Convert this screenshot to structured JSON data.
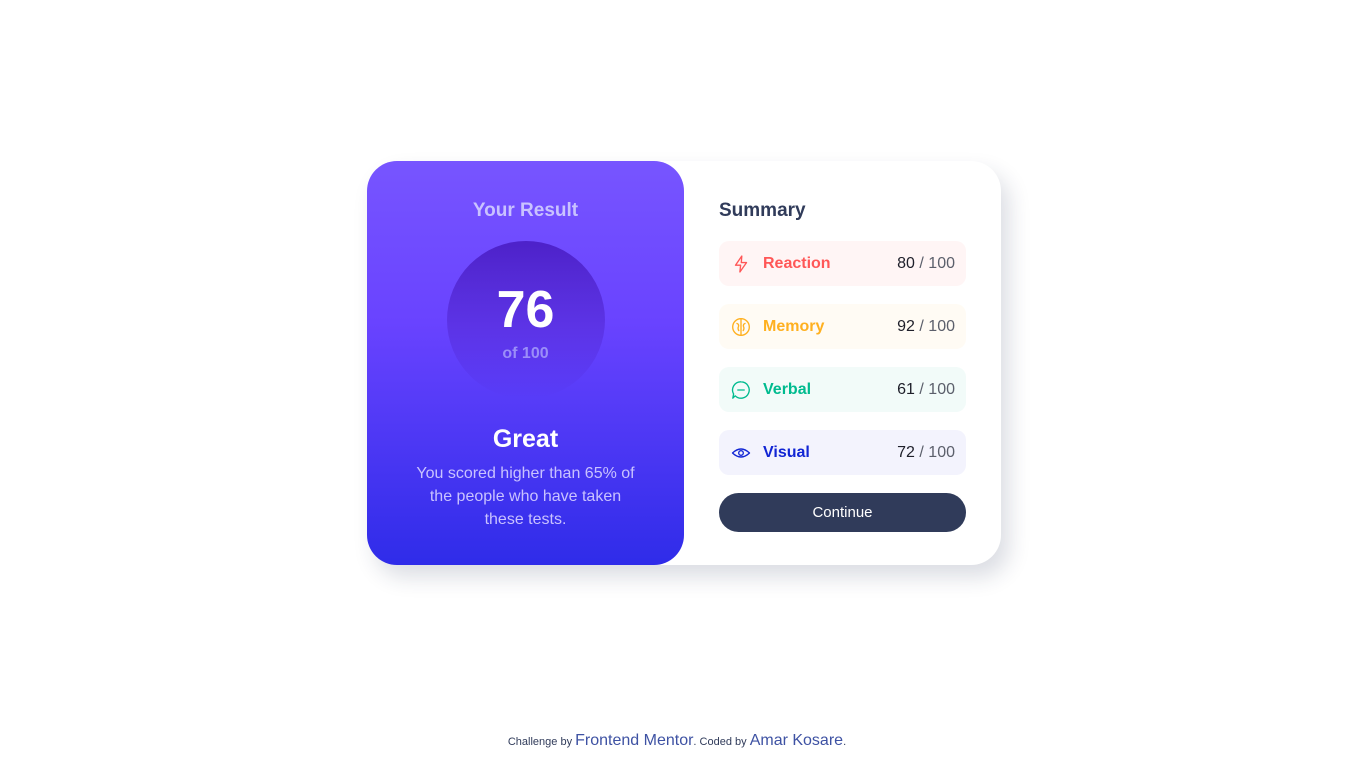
{
  "result": {
    "title": "Your Result",
    "score": "76",
    "score_max": "of 100",
    "rating": "Great",
    "description": "You scored higher than 65% of the people who have taken these tests."
  },
  "summary": {
    "title": "Summary",
    "items": [
      {
        "label": "Reaction",
        "score": "80",
        "max": "/ 100",
        "icon": "lightning-icon",
        "color": "#ff5757",
        "bg": "#fff5f5"
      },
      {
        "label": "Memory",
        "score": "92",
        "max": "/ 100",
        "icon": "brain-icon",
        "color": "#ffb01f",
        "bg": "#fffbf4"
      },
      {
        "label": "Verbal",
        "score": "61",
        "max": "/ 100",
        "icon": "chat-bubble-icon",
        "color": "#00bb8f",
        "bg": "#f2fbf9"
      },
      {
        "label": "Visual",
        "score": "72",
        "max": "/ 100",
        "icon": "eye-icon",
        "color": "#1125d4",
        "bg": "#f3f3fd"
      }
    ],
    "continue_label": "Continue"
  },
  "attribution": {
    "challenge_prefix": "Challenge by",
    "challenge_link": "Frontend Mentor",
    "coded_prefix": ". Coded by",
    "author_link": "Amar Kosare",
    "suffix": "."
  }
}
